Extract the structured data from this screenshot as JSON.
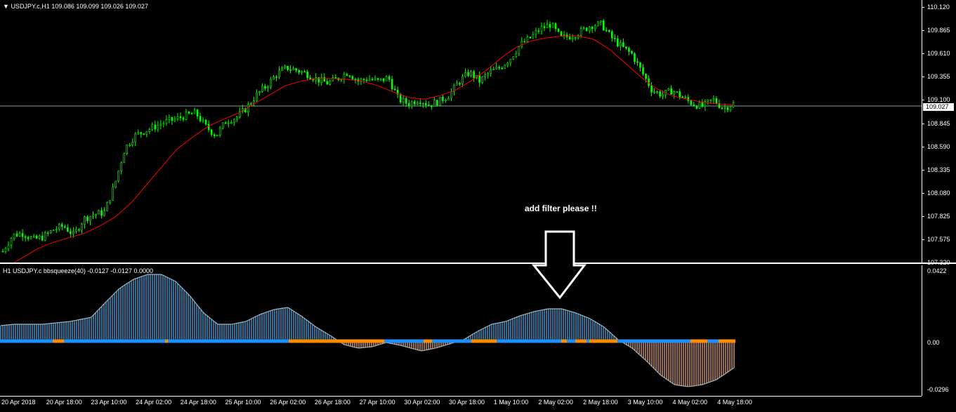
{
  "chart_window": {
    "title": "USDJPY.c,H1",
    "ohlc": "109.086 109.099 109.026 109.027",
    "current_price": "109.027",
    "price_axis": [
      "110.120",
      "109.865",
      "109.610",
      "109.355",
      "109.100",
      "108.845",
      "108.590",
      "108.335",
      "108.080",
      "107.825",
      "107.575",
      "107.320"
    ],
    "colors": {
      "candle": "#00ff00",
      "ma": "#ff0000",
      "background": "#000000",
      "grid_line": "#8a9aa8"
    }
  },
  "indicator": {
    "title": "H1 USDJPY.c bbsqueeze(40) -0.0127 -0.0127 0.0000",
    "axis": [
      "0.0422",
      "0.00",
      "-0.0296"
    ],
    "colors": {
      "positive": "#4aa8e0",
      "negative": "#e8a878",
      "dot_blue": "#1e90ff",
      "dot_orange": "#ff8c00"
    }
  },
  "annotation": {
    "text": "add filter please !!"
  },
  "time_axis": [
    "20 Apr 2018",
    "20 Apr 18:00",
    "23 Apr 10:00",
    "24 Apr 02:00",
    "24 Apr 18:00",
    "25 Apr 10:00",
    "26 Apr 02:00",
    "26 Apr 18:00",
    "27 Apr 10:00",
    "30 Apr 02:00",
    "30 Apr 18:00",
    "1 May 10:00",
    "2 May 02:00",
    "2 May 18:00",
    "3 May 10:00",
    "4 May 02:00",
    "4 May 18:00"
  ],
  "chart_data": {
    "type": "candlestick",
    "title": "USDJPY.c,H1",
    "y_range": [
      107.32,
      110.12
    ],
    "close_path": [
      107.42,
      107.6,
      107.62,
      107.55,
      107.58,
      107.66,
      107.7,
      107.6,
      107.78,
      107.83,
      107.85,
      108.15,
      108.55,
      108.7,
      108.75,
      108.8,
      108.85,
      108.88,
      108.92,
      108.95,
      108.8,
      108.7,
      108.86,
      108.9,
      109.0,
      109.15,
      109.25,
      109.38,
      109.45,
      109.42,
      109.38,
      109.32,
      109.28,
      109.33,
      109.4,
      109.3,
      109.33,
      109.3,
      109.34,
      109.1,
      109.05,
      109.1,
      109.04,
      109.08,
      109.15,
      109.3,
      109.4,
      109.3,
      109.4,
      109.45,
      109.55,
      109.7,
      109.78,
      109.88,
      109.93,
      109.78,
      109.8,
      109.85,
      109.92,
      109.93,
      109.78,
      109.68,
      109.6,
      109.4,
      109.2,
      109.15,
      109.2,
      109.12,
      109.05,
      109.02,
      109.1,
      109.0,
      109.05
    ],
    "ma_path": [
      107.25,
      107.35,
      107.45,
      107.52,
      107.57,
      107.62,
      107.7,
      107.8,
      107.95,
      108.15,
      108.35,
      108.55,
      108.68,
      108.8,
      108.88,
      108.95,
      109.05,
      109.15,
      109.25,
      109.3,
      109.33,
      109.33,
      109.32,
      109.3,
      109.25,
      109.18,
      109.12,
      109.1,
      109.14,
      109.2,
      109.3,
      109.42,
      109.56,
      109.68,
      109.75,
      109.78,
      109.8,
      109.8,
      109.76,
      109.65,
      109.5,
      109.35,
      109.22,
      109.14,
      109.1,
      109.07,
      109.05,
      109.04
    ]
  }
}
